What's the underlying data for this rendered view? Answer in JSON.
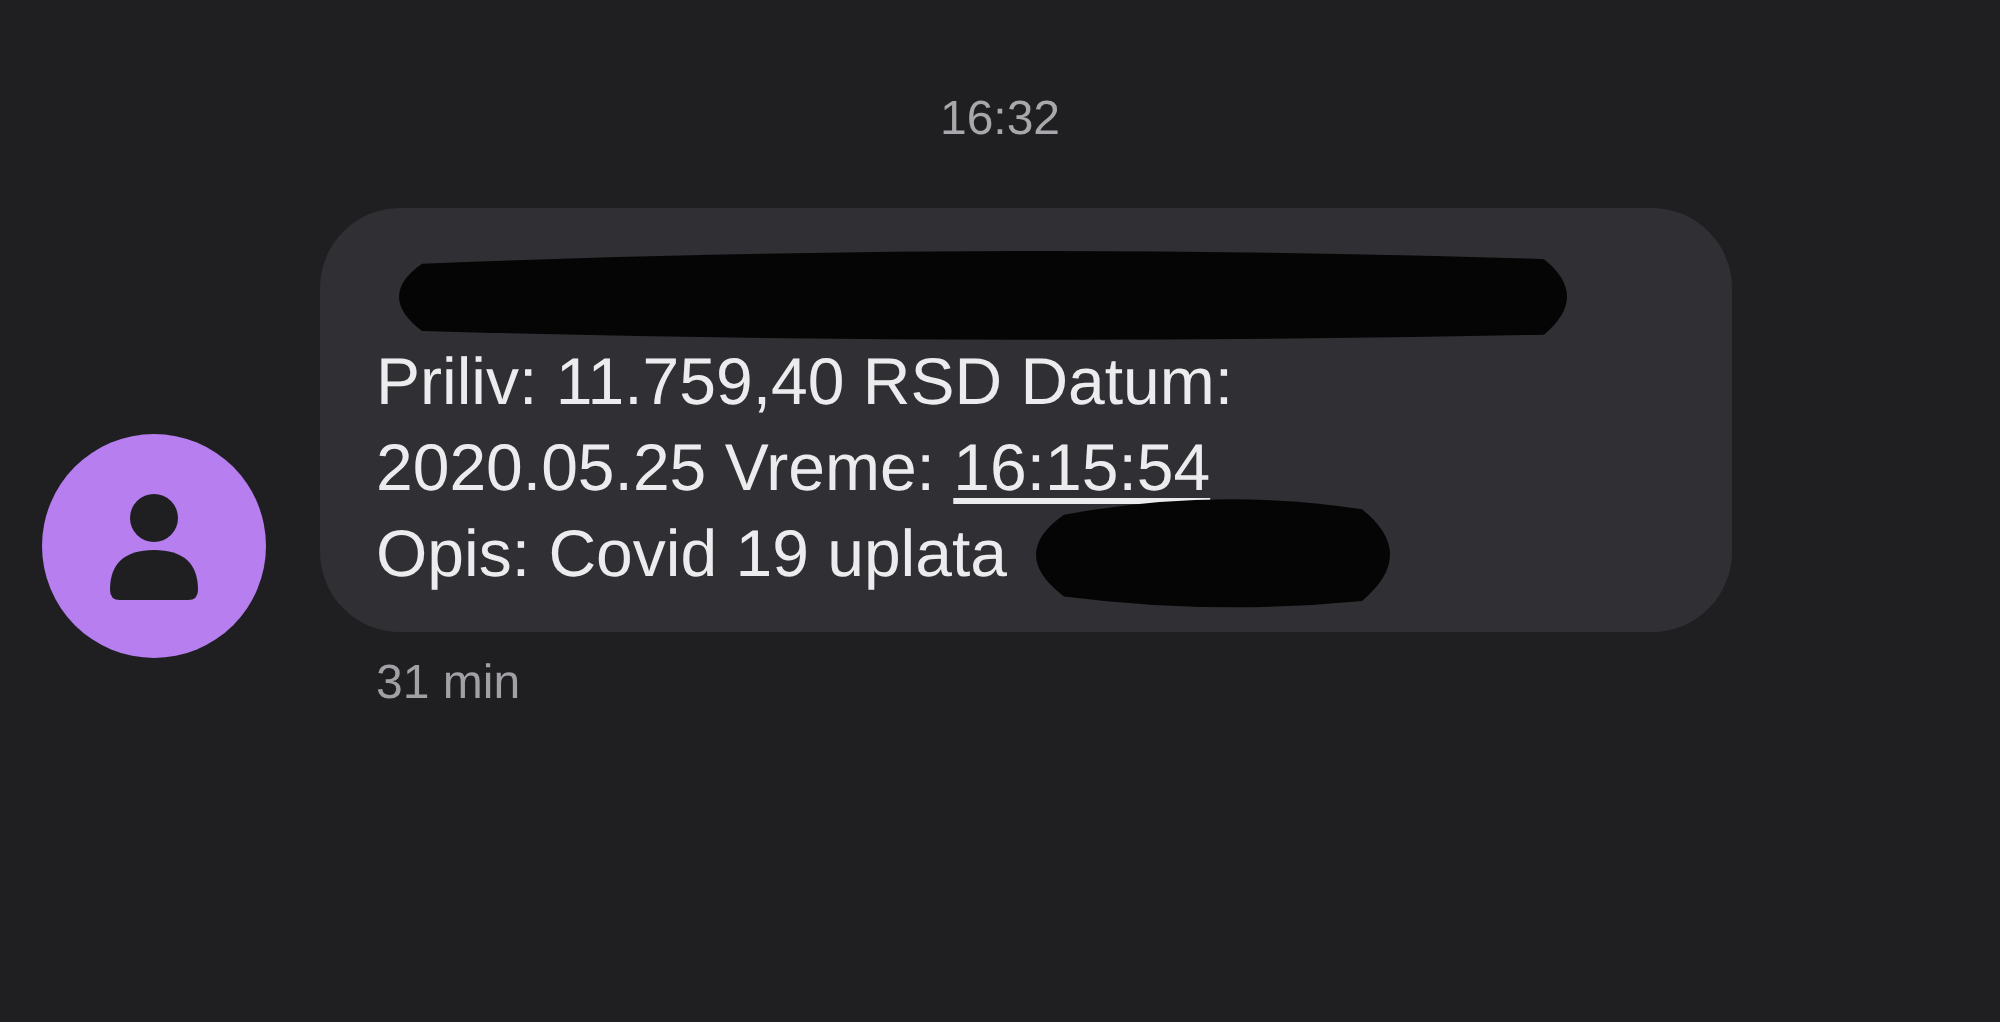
{
  "timestamp": "16:32",
  "message": {
    "lines": [
      {
        "kind": "redacted"
      },
      {
        "kind": "text",
        "text": "Priliv: 11.759,40 RSD Datum:"
      },
      {
        "kind": "text",
        "text": "2020.05.25 Vreme: ",
        "link": "16:15:54"
      },
      {
        "kind": "text",
        "text": "Opis: Covid 19 uplata",
        "redacted_after": true
      }
    ],
    "age": "31 min"
  }
}
